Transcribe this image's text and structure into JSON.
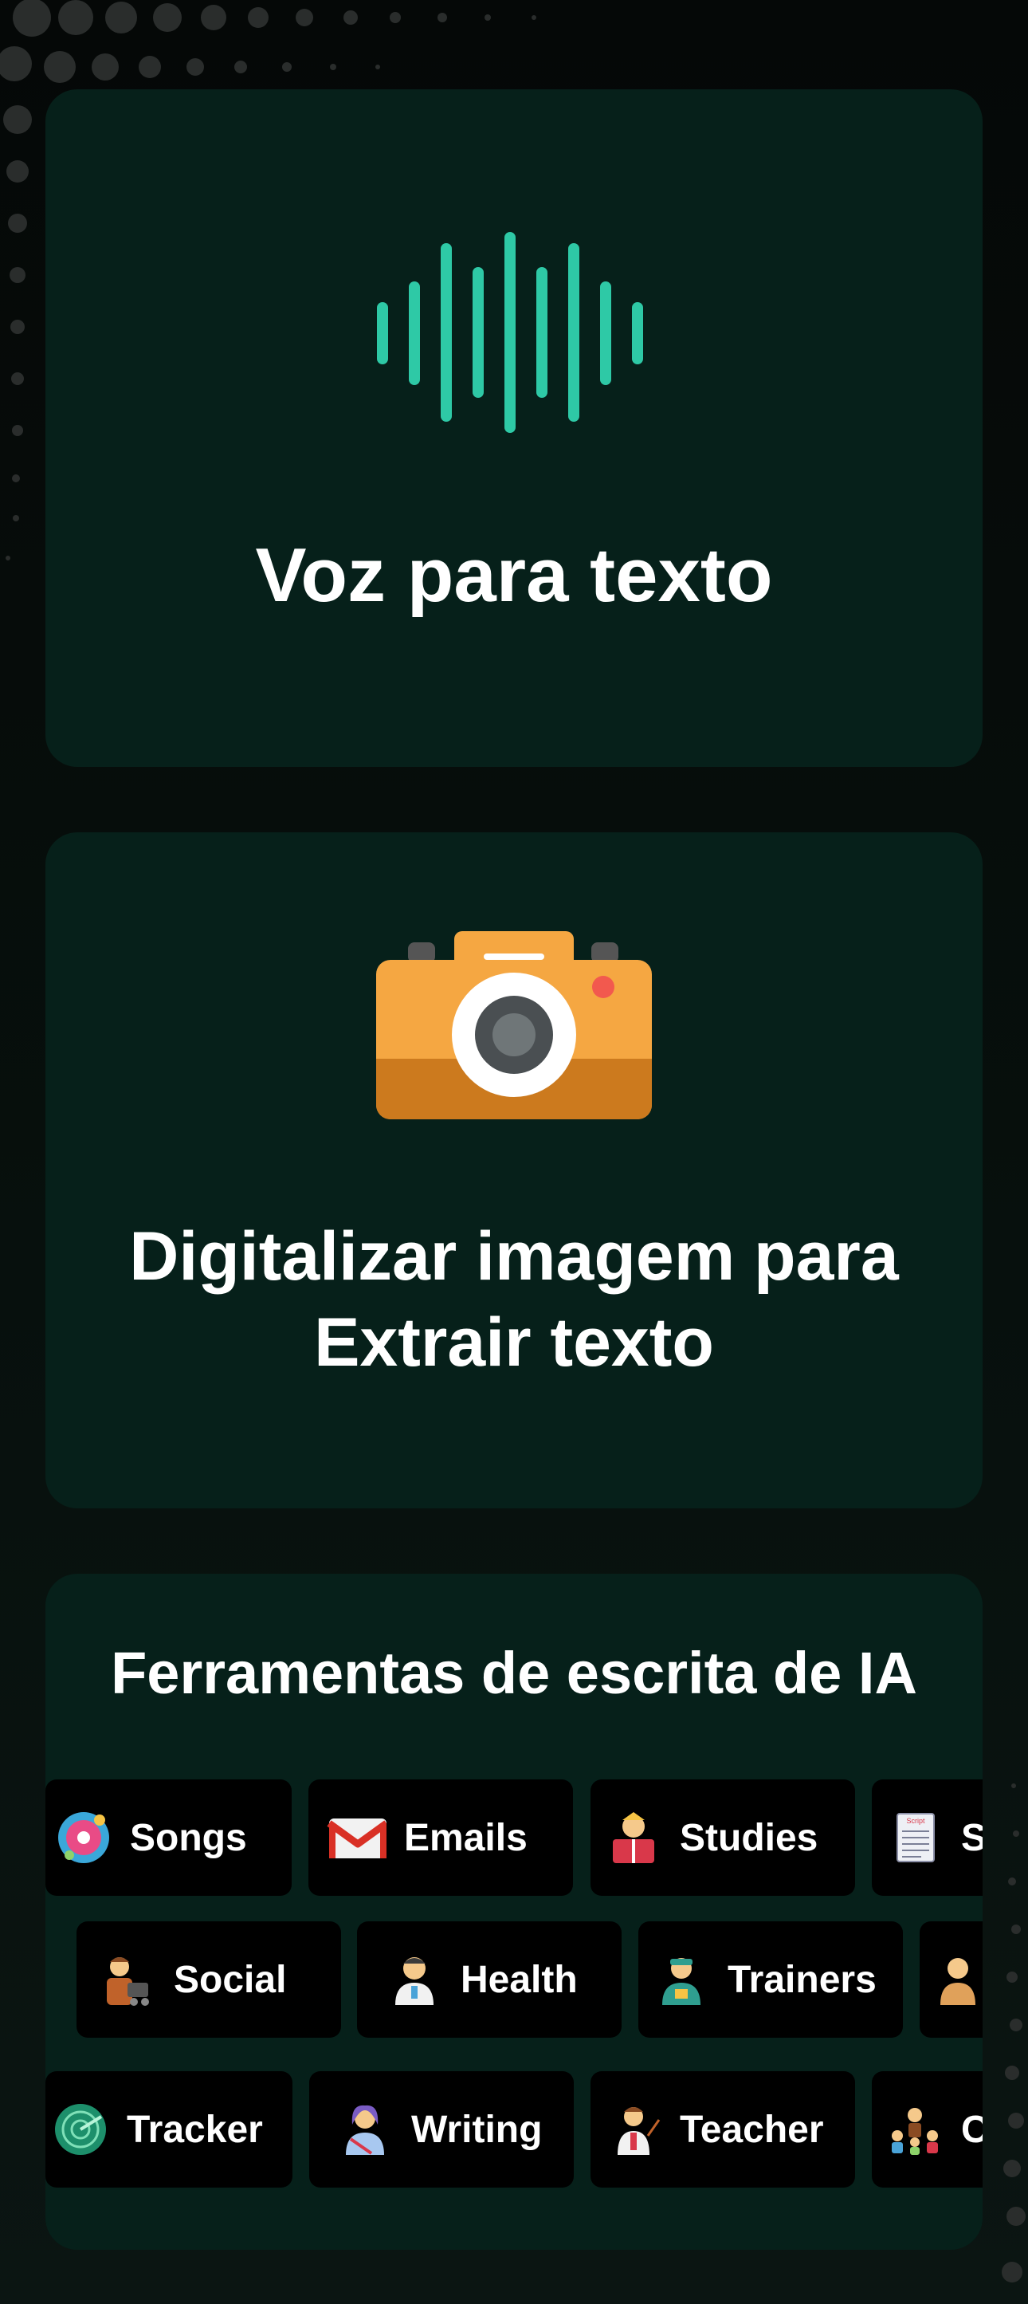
{
  "voice_card": {
    "title": "Voz para texto",
    "icon": "sound-wave-icon",
    "accent": "#2ec9a6"
  },
  "scan_card": {
    "title_line1": "Digitalizar imagem para",
    "title_line2": "Extrair texto",
    "icon": "camera-icon"
  },
  "tools_card": {
    "title": "Ferramentas de escrita de IA",
    "rows": [
      [
        {
          "label": "Songs",
          "icon": "music-disc-icon"
        },
        {
          "label": "Emails",
          "icon": "gmail-icon"
        },
        {
          "label": "Studies",
          "icon": "student-reading-icon"
        },
        {
          "label": "S",
          "icon": "script-document-icon"
        }
      ],
      [
        {
          "label": "Social",
          "icon": "videographer-icon"
        },
        {
          "label": "Health",
          "icon": "doctor-icon"
        },
        {
          "label": "Trainers",
          "icon": "trainer-icon"
        },
        {
          "label": "",
          "icon": "person-icon"
        }
      ],
      [
        {
          "label": "Tracker",
          "icon": "radar-icon"
        },
        {
          "label": "Writing",
          "icon": "writer-icon"
        },
        {
          "label": "Teacher",
          "icon": "teacher-icon"
        },
        {
          "label": "Co",
          "icon": "community-icon"
        }
      ]
    ]
  }
}
